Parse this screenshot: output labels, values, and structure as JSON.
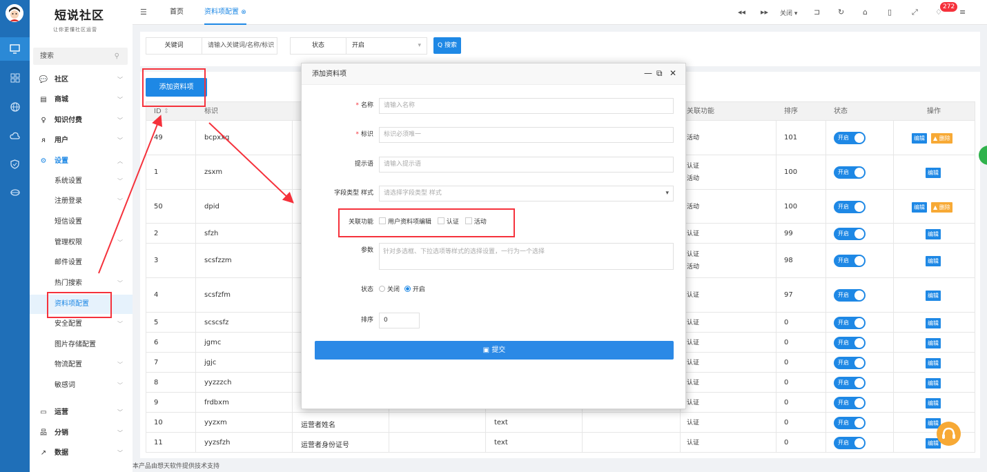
{
  "brand": {
    "name": "短说社区",
    "slogan": "让你更懂社区运营"
  },
  "sidebar": {
    "search_label": "搜索",
    "items": [
      {
        "label": "社区",
        "icon": "chat-icon"
      },
      {
        "label": "商城",
        "icon": "store-icon"
      },
      {
        "label": "知识付费",
        "icon": "bulb-icon"
      },
      {
        "label": "用户",
        "icon": "users-icon"
      },
      {
        "label": "设置",
        "icon": "gear-icon"
      },
      {
        "label": "运营",
        "icon": "monitor-icon"
      },
      {
        "label": "分销",
        "icon": "network-icon"
      },
      {
        "label": "数据",
        "icon": "chart-icon"
      }
    ],
    "submenu": [
      "系统设置",
      "注册登录",
      "短信设置",
      "管理权限",
      "邮件设置",
      "热门搜索",
      "资料项配置",
      "安全配置",
      "图片存储配置",
      "物流配置",
      "敏感词"
    ]
  },
  "topbar": {
    "tabs": [
      "首页",
      "资料项配置"
    ],
    "close_label": "关闭",
    "notif_count": "272"
  },
  "filter": {
    "keyword_label": "关键词",
    "keyword_placeholder": "请输入关键词/名称/标识",
    "status_label": "状态",
    "status_value": "开启",
    "search_button": "Q 搜索"
  },
  "add_button": "添加资料项",
  "table": {
    "headers": [
      "ID",
      "标识",
      "关联功能",
      "排序",
      "状态",
      "操作"
    ],
    "rows": [
      {
        "id": "49",
        "key": "bcpxxq",
        "name": "",
        "type": "",
        "func": [
          "活动"
        ],
        "sort": "101",
        "del": true
      },
      {
        "id": "1",
        "key": "zsxm",
        "name": "",
        "type": "",
        "func": [
          "认证",
          "活动"
        ],
        "sort": "100",
        "del": false
      },
      {
        "id": "50",
        "key": "dpid",
        "name": "",
        "type": "",
        "func": [
          "活动"
        ],
        "sort": "100",
        "del": true
      },
      {
        "id": "2",
        "key": "sfzh",
        "name": "",
        "type": "",
        "func": [
          "认证"
        ],
        "sort": "99",
        "del": false
      },
      {
        "id": "3",
        "key": "scsfzzm",
        "name": "",
        "type": "",
        "func": [
          "认证",
          "活动"
        ],
        "sort": "98",
        "del": false
      },
      {
        "id": "4",
        "key": "scsfzfm",
        "name": "",
        "type": "",
        "func": [
          "认证"
        ],
        "sort": "97",
        "del": false
      },
      {
        "id": "5",
        "key": "scscsfz",
        "name": "",
        "type": "",
        "func": [
          "认证"
        ],
        "sort": "0",
        "del": false
      },
      {
        "id": "6",
        "key": "jgmc",
        "name": "",
        "type": "",
        "func": [
          "认证"
        ],
        "sort": "0",
        "del": false
      },
      {
        "id": "7",
        "key": "jgjc",
        "name": "",
        "type": "",
        "func": [
          "认证"
        ],
        "sort": "0",
        "del": false
      },
      {
        "id": "8",
        "key": "yyzzzch",
        "name": "",
        "type": "",
        "func": [
          "认证"
        ],
        "sort": "0",
        "del": false
      },
      {
        "id": "9",
        "key": "frdbxm",
        "name": "",
        "type": "",
        "func": [
          "认证"
        ],
        "sort": "0",
        "del": false
      },
      {
        "id": "10",
        "key": "yyzxm",
        "name": "运营者姓名",
        "type": "text",
        "func": [
          "认证"
        ],
        "sort": "0",
        "del": false
      },
      {
        "id": "11",
        "key": "yyzsfzh",
        "name": "运营者身份证号",
        "type": "text",
        "func": [
          "认证"
        ],
        "sort": "0",
        "del": false
      }
    ],
    "toggle_label": "开启",
    "edit_label": "编辑",
    "delete_label": "▲ 删除"
  },
  "modal": {
    "title": "添加资料项",
    "name_label": "名称",
    "name_placeholder": "请输入名称",
    "key_label": "标识",
    "key_placeholder": "标识必须唯一",
    "hint_label": "提示语",
    "hint_placeholder": "请输入提示语",
    "fieldtype_label": "字段类型 样式",
    "fieldtype_placeholder": "请选择字段类型 样式",
    "func_label": "关联功能",
    "func_options": [
      "用户资料项编辑",
      "认证",
      "活动"
    ],
    "params_label": "参数",
    "params_placeholder": "针对多选框、下拉选项等样式的选择设置，一行为一个选择",
    "status_label": "状态",
    "status_options": [
      "关闭",
      "开启"
    ],
    "sort_label": "排序",
    "sort_value": "0",
    "submit_label": "提交"
  },
  "footer": "本产品由想天软件提供技术支持",
  "colors": {
    "primary": "#1e88e5",
    "danger": "#f5313b",
    "warning": "#f7a935"
  }
}
